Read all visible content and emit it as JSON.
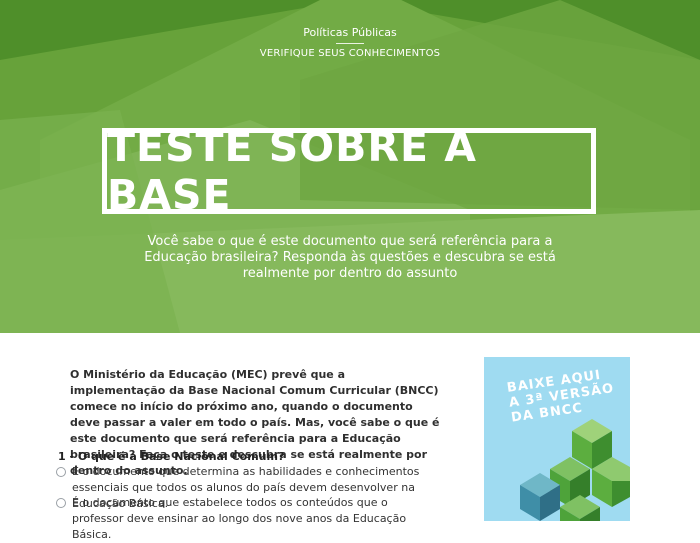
{
  "header": {
    "category": "Políticas Públicas",
    "section": "VERIFIQUE SEUS CONHECIMENTOS"
  },
  "hero": {
    "title": "TESTE SOBRE A BASE",
    "subtitle": "Você sabe o que é este documento que será referência para a Educação brasileira? Responda às questões e descubra se está realmente por dentro do assunto"
  },
  "article": {
    "intro": "O Ministério da Educação (MEC) prevê que a implementação da Base Nacional Comum Curricular (BNCC) comece no início do próximo ano, quando o documento deve passar a valer em todo o país. Mas, você sabe o que é este documento que será referência para a Educação brasileira? Faça o teste e descubra se está realmente por dentro do assunto."
  },
  "quiz": {
    "question_1": {
      "title": "1 - O que é a Base Nacional Comum?",
      "options": [
        "É o documento que determina as habilidades e conhecimentos essenciais que todos os alunos do país devem desenvolver na Educação Básica.",
        "É o documento que estabelece todos os conteúdos que o professor deve ensinar ao longo dos nove anos da Educação Básica."
      ]
    }
  },
  "banner": {
    "lines": [
      "BAIXE AQUI",
      "A 3ª VERSÃO",
      "DA BNCC"
    ]
  },
  "colors": {
    "hero_green": "#6aa33c",
    "banner_blue": "#9fdbf1",
    "cube_green": "#5fb34a"
  }
}
